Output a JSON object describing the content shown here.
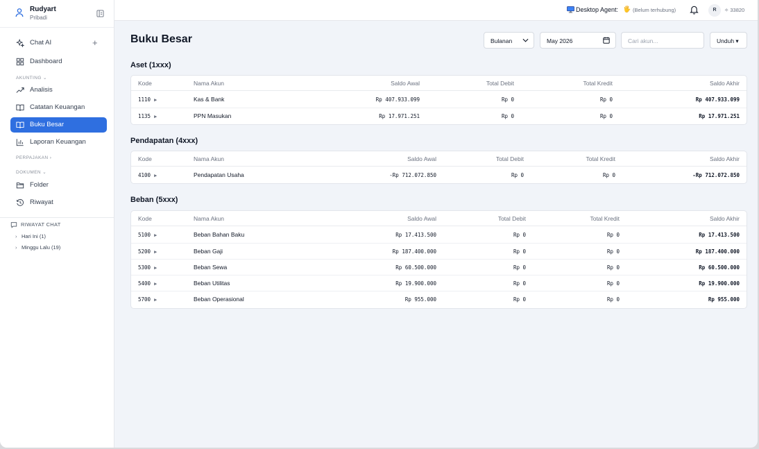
{
  "user": {
    "name": "Rudyart",
    "subtitle": "Pribadi"
  },
  "nav": {
    "chat": "Chat AI",
    "dashboard": "Dashboard",
    "section_akunting": "AKUNTING ⌄",
    "analisis": "Analisis",
    "catatan": "Catatan Keuangan",
    "buku_besar": "Buku Besar",
    "laporan": "Laporan Keuangan",
    "section_perpajakan": "PERPAJAKAN ›",
    "section_dokumen": "DOKUMEN ⌄",
    "folder": "Folder",
    "riwayat": "Riwayat"
  },
  "riwayat_chat": {
    "title": "RIWAYAT CHAT",
    "items": [
      "Hari Ini (1)",
      "Minggu Lalu (19)"
    ]
  },
  "topbar": {
    "agent_label": "Desktop Agent:",
    "agent_status": "(Belum terhubung)",
    "avatar": "R",
    "credits": "✧ 33820"
  },
  "page": {
    "title": "Buku Besar",
    "period_select": "Bulanan",
    "month": "May 2026",
    "search_placeholder": "Cari akun...",
    "download": "Unduh ▾"
  },
  "columns": [
    "Kode",
    "Nama Akun",
    "Saldo Awal",
    "Total Debit",
    "Total Kredit",
    "Saldo Akhir"
  ],
  "groups": [
    {
      "title": "Aset (1xxx)",
      "rows": [
        {
          "kode": "1110",
          "nama": "Kas & Bank",
          "awal": "Rp 407.933.099",
          "debit": "Rp 0",
          "kredit": "Rp 0",
          "akhir": "Rp 407.933.099"
        },
        {
          "kode": "1135",
          "nama": "PPN Masukan",
          "awal": "Rp 17.971.251",
          "debit": "Rp 0",
          "kredit": "Rp 0",
          "akhir": "Rp 17.971.251"
        }
      ]
    },
    {
      "title": "Pendapatan (4xxx)",
      "rows": [
        {
          "kode": "4100",
          "nama": "Pendapatan Usaha",
          "awal": "-Rp 712.072.850",
          "debit": "Rp 0",
          "kredit": "Rp 0",
          "akhir": "-Rp 712.072.850"
        }
      ]
    },
    {
      "title": "Beban (5xxx)",
      "rows": [
        {
          "kode": "5100",
          "nama": "Beban Bahan Baku",
          "awal": "Rp 17.413.500",
          "debit": "Rp 0",
          "kredit": "Rp 0",
          "akhir": "Rp 17.413.500"
        },
        {
          "kode": "5200",
          "nama": "Beban Gaji",
          "awal": "Rp 187.400.000",
          "debit": "Rp 0",
          "kredit": "Rp 0",
          "akhir": "Rp 187.400.000"
        },
        {
          "kode": "5300",
          "nama": "Beban Sewa",
          "awal": "Rp 60.500.000",
          "debit": "Rp 0",
          "kredit": "Rp 0",
          "akhir": "Rp 60.500.000"
        },
        {
          "kode": "5400",
          "nama": "Beban Utilitas",
          "awal": "Rp 19.900.000",
          "debit": "Rp 0",
          "kredit": "Rp 0",
          "akhir": "Rp 19.900.000"
        },
        {
          "kode": "5700",
          "nama": "Beban Operasional",
          "awal": "Rp 955.000",
          "debit": "Rp 0",
          "kredit": "Rp 0",
          "akhir": "Rp 955.000"
        }
      ]
    }
  ],
  "icons": {
    "user": "user-icon",
    "collapse": "sidebar-collapse-icon",
    "sparkle": "sparkle-icon",
    "grid": "dashboard-grid-icon",
    "trend": "trend-up-icon",
    "book": "book-open-icon",
    "chart": "bar-chart-icon",
    "folder": "folder-icon",
    "history": "history-icon",
    "chat": "chat-bubble-icon",
    "monitor": "monitor-icon",
    "bell": "bell-icon",
    "calendar": "calendar-icon",
    "expand": "expand-triangle-icon"
  },
  "colors": {
    "accent": "#2f6fe0",
    "background": "#f1f4f9"
  }
}
